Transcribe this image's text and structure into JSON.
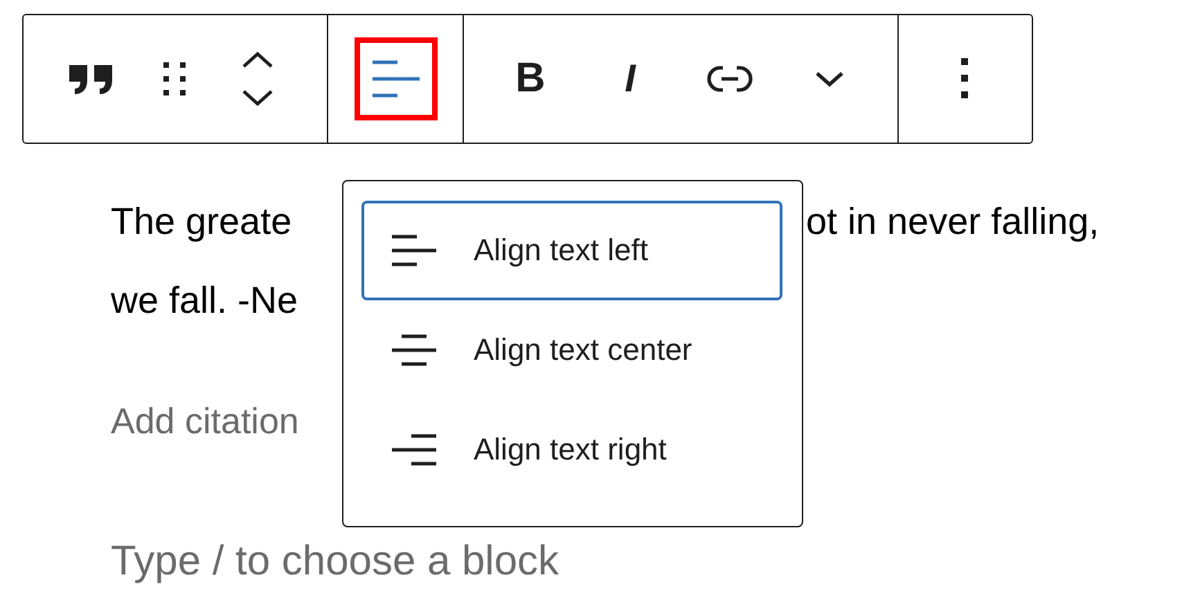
{
  "toolbar": {
    "groups": [
      {
        "buttons": [
          {
            "kind": "quote"
          },
          {
            "kind": "drag"
          },
          {
            "kind": "mover"
          }
        ]
      },
      {
        "buttons": [
          {
            "kind": "align",
            "highlighted": true
          }
        ]
      },
      {
        "buttons": [
          {
            "kind": "bold",
            "label": "B"
          },
          {
            "kind": "italic",
            "label": "I"
          },
          {
            "kind": "link"
          },
          {
            "kind": "more"
          }
        ]
      },
      {
        "buttons": [
          {
            "kind": "options"
          }
        ]
      }
    ]
  },
  "quote": {
    "lines": [
      {
        "left": "The greate",
        "right": "ot in never falling,"
      },
      {
        "left": "we fall. -Ne"
      }
    ],
    "citation_placeholder": "Add citation"
  },
  "alignment_menu": {
    "items": [
      {
        "kind": "left",
        "label": "Align text left",
        "selected": true
      },
      {
        "kind": "center",
        "label": "Align text center",
        "selected": false
      },
      {
        "kind": "right",
        "label": "Align text right",
        "selected": false
      }
    ]
  },
  "block_placeholder": "Type / to choose a block"
}
